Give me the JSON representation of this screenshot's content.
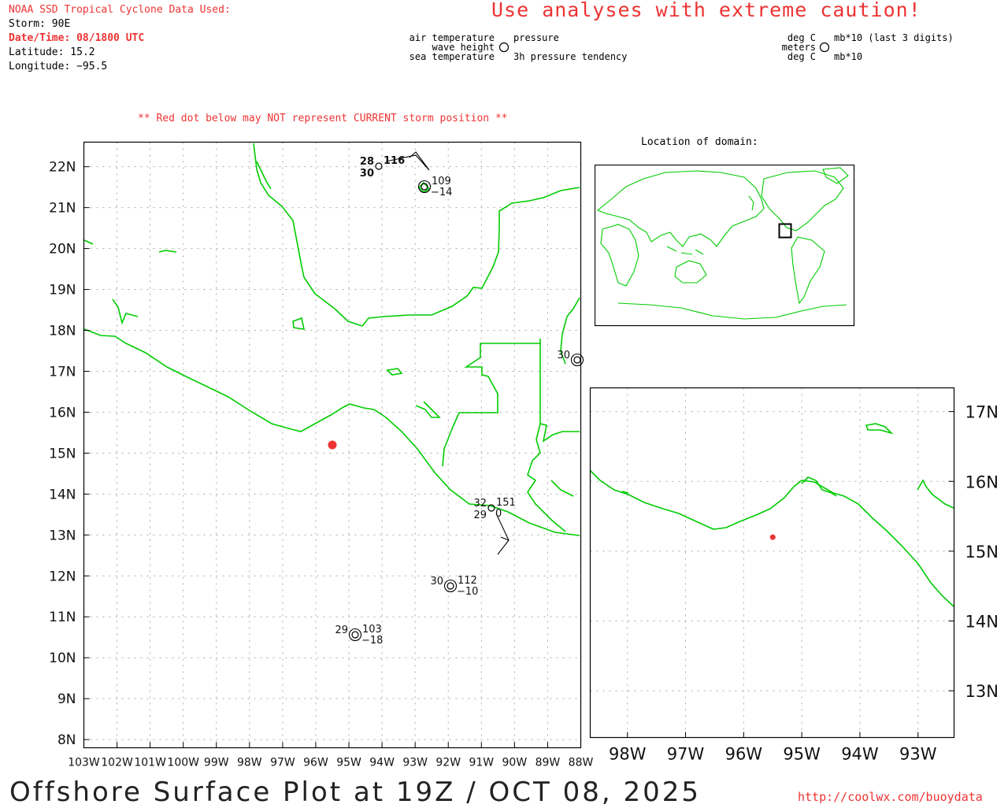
{
  "header": {
    "source_title": "NOAA SSD Tropical Cyclone Data Used:",
    "storm": "Storm: 90E",
    "datetime": "Date/Time: 08/1800 UTC",
    "latitude": "Latitude: 15.2",
    "longitude": "Longitude: −95.5",
    "caution": "Use analyses with extreme caution!"
  },
  "legend": {
    "air_temperature": "air temperature",
    "wave_height": "wave height",
    "sea_temperature": "sea temperature",
    "pressure": "pressure",
    "pressure_tendency": "3h pressure tendency",
    "unit_air": "deg C",
    "unit_wave": "meters",
    "unit_sea": "deg C",
    "unit_pressure": "mb*10 (last 3 digits)",
    "unit_tendency": "mb*10"
  },
  "notice": "** Red dot below may NOT represent CURRENT storm position **",
  "locator": {
    "title": "Location of domain:"
  },
  "main_map": {
    "lat_labels": [
      "22N",
      "21N",
      "20N",
      "19N",
      "18N",
      "17N",
      "16N",
      "15N",
      "14N",
      "13N",
      "12N",
      "11N",
      "10N",
      "9N",
      "8N"
    ],
    "lon_labels": [
      "103W",
      "102W",
      "101W",
      "100W",
      "99W",
      "98W",
      "97W",
      "96W",
      "95W",
      "94W",
      "93W",
      "92W",
      "91W",
      "90W",
      "89W",
      "88W"
    ],
    "storm_position": {
      "lat": 15.2,
      "lon": -95.5
    },
    "stations": [
      {
        "id": "st1",
        "air": "28",
        "sea": "30",
        "pressure": "116",
        "tendency": ""
      },
      {
        "id": "st2",
        "air": "",
        "sea": "",
        "pressure": "109",
        "tendency": "−14"
      },
      {
        "id": "st3",
        "air": "30",
        "sea": "",
        "pressure": "",
        "tendency": ""
      },
      {
        "id": "st4",
        "air": "32",
        "sea": "29",
        "pressure": "151",
        "tendency": "0"
      },
      {
        "id": "st5",
        "air": "30",
        "sea": "",
        "pressure": "112",
        "tendency": "−10"
      },
      {
        "id": "st6",
        "air": "29",
        "sea": "",
        "pressure": "103",
        "tendency": "−18"
      }
    ]
  },
  "zoom_map": {
    "lat_labels": [
      "17N",
      "16N",
      "15N",
      "14N",
      "13N"
    ],
    "lon_labels": [
      "98W",
      "97W",
      "96W",
      "95W",
      "94W",
      "93W"
    ]
  },
  "footer": {
    "title": "Offshore Surface Plot at 19Z / OCT 08, 2025",
    "url": "http://coolwx.com/buoydata"
  },
  "colors": {
    "coast": "#00cc00",
    "text_red": "#ee3333",
    "storm_dot": "#ee3333",
    "grid": "#aaaaaa"
  }
}
